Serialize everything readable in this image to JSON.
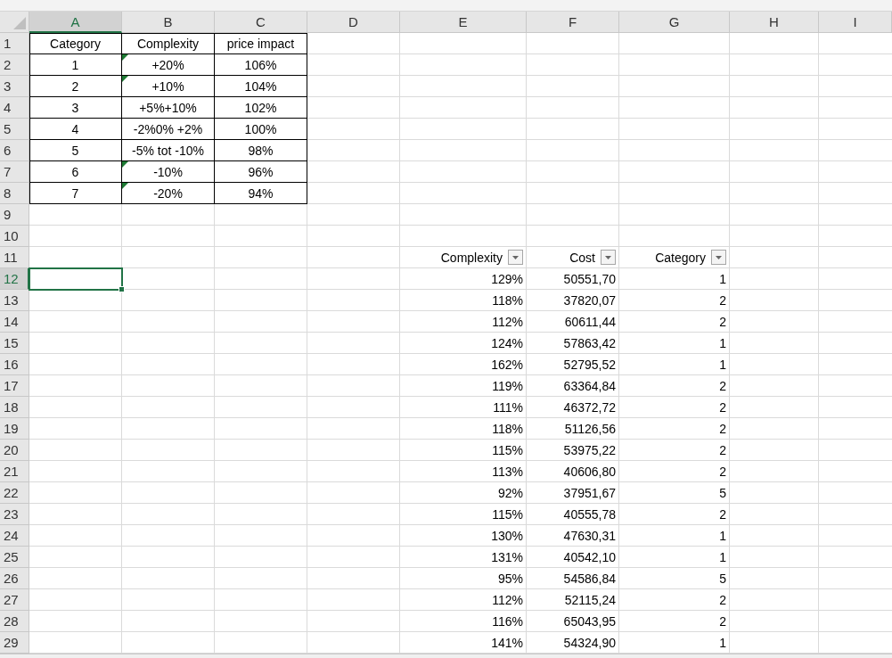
{
  "column_headers": [
    {
      "label": "A",
      "selected": true
    },
    {
      "label": "B",
      "selected": false
    },
    {
      "label": "C",
      "selected": false
    },
    {
      "label": "D",
      "selected": false
    },
    {
      "label": "E",
      "selected": false
    },
    {
      "label": "F",
      "selected": false
    },
    {
      "label": "G",
      "selected": false
    },
    {
      "label": "H",
      "selected": false
    },
    {
      "label": "I",
      "selected": false
    }
  ],
  "row_headers": [
    {
      "label": "1",
      "selected": false
    },
    {
      "label": "2",
      "selected": false
    },
    {
      "label": "3",
      "selected": false
    },
    {
      "label": "4",
      "selected": false
    },
    {
      "label": "5",
      "selected": false
    },
    {
      "label": "6",
      "selected": false
    },
    {
      "label": "7",
      "selected": false
    },
    {
      "label": "8",
      "selected": false
    },
    {
      "label": "9",
      "selected": false
    },
    {
      "label": "10",
      "selected": false
    },
    {
      "label": "11",
      "selected": false
    },
    {
      "label": "12",
      "selected": true
    },
    {
      "label": "13",
      "selected": false
    },
    {
      "label": "14",
      "selected": false
    },
    {
      "label": "15",
      "selected": false
    },
    {
      "label": "16",
      "selected": false
    },
    {
      "label": "17",
      "selected": false
    },
    {
      "label": "18",
      "selected": false
    },
    {
      "label": "19",
      "selected": false
    },
    {
      "label": "20",
      "selected": false
    },
    {
      "label": "21",
      "selected": false
    },
    {
      "label": "22",
      "selected": false
    },
    {
      "label": "23",
      "selected": false
    },
    {
      "label": "24",
      "selected": false
    },
    {
      "label": "25",
      "selected": false
    },
    {
      "label": "26",
      "selected": false
    },
    {
      "label": "27",
      "selected": false
    },
    {
      "label": "28",
      "selected": false
    },
    {
      "label": "29",
      "selected": false
    }
  ],
  "price_table": {
    "columns": [
      "Category",
      "Complexity",
      "price impact"
    ],
    "rows": [
      {
        "category": "1",
        "complexity": "+20%",
        "price_impact": "106%",
        "error_flag": true
      },
      {
        "category": "2",
        "complexity": "+10%",
        "price_impact": "104%",
        "error_flag": true
      },
      {
        "category": "3",
        "complexity": "+5%+10%",
        "price_impact": "102%",
        "error_flag": false
      },
      {
        "category": "4",
        "complexity": "-2%0% +2%",
        "price_impact": "100%",
        "error_flag": false
      },
      {
        "category": "5",
        "complexity": "-5% tot -10%",
        "price_impact": "98%",
        "error_flag": false
      },
      {
        "category": "6",
        "complexity": "-10%",
        "price_impact": "96%",
        "error_flag": true
      },
      {
        "category": "7",
        "complexity": "-20%",
        "price_impact": "94%",
        "error_flag": true
      }
    ]
  },
  "data_table": {
    "columns": [
      "Complexity",
      "Cost",
      "Category"
    ],
    "rows": [
      [
        "129%",
        "50551,70",
        "1"
      ],
      [
        "118%",
        "37820,07",
        "2"
      ],
      [
        "112%",
        "60611,44",
        "2"
      ],
      [
        "124%",
        "57863,42",
        "1"
      ],
      [
        "162%",
        "52795,52",
        "1"
      ],
      [
        "119%",
        "63364,84",
        "2"
      ],
      [
        "111%",
        "46372,72",
        "2"
      ],
      [
        "118%",
        "51126,56",
        "2"
      ],
      [
        "115%",
        "53975,22",
        "2"
      ],
      [
        "113%",
        "40606,80",
        "2"
      ],
      [
        "92%",
        "37951,67",
        "5"
      ],
      [
        "115%",
        "40555,78",
        "2"
      ],
      [
        "130%",
        "47630,31",
        "1"
      ],
      [
        "131%",
        "40542,10",
        "1"
      ],
      [
        "95%",
        "54586,84",
        "5"
      ],
      [
        "112%",
        "52115,24",
        "2"
      ],
      [
        "116%",
        "65043,95",
        "2"
      ],
      [
        "141%",
        "54324,90",
        "1"
      ]
    ]
  }
}
